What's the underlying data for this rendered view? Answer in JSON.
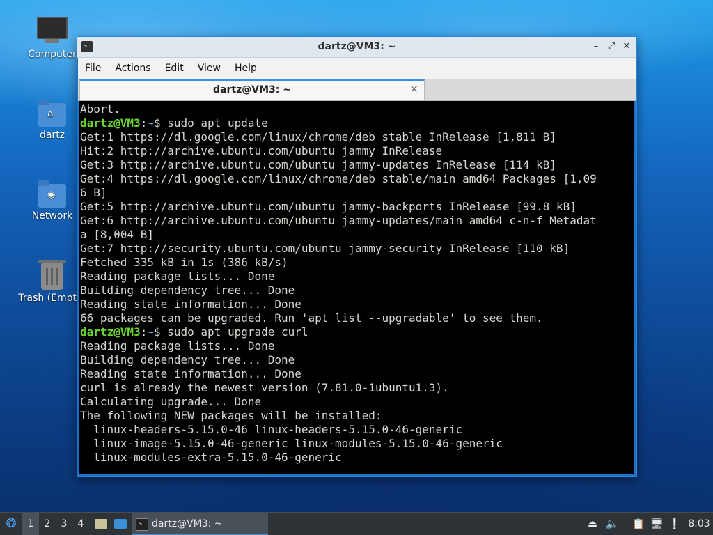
{
  "desktop": {
    "icons": [
      {
        "label": "Computer",
        "icon": "computer-icon"
      },
      {
        "label": "dartz",
        "icon": "home-folder-icon"
      },
      {
        "label": "Network",
        "icon": "network-folder-icon"
      },
      {
        "label": "Trash (Empty)",
        "icon": "trash-icon"
      }
    ]
  },
  "window": {
    "title": "dartz@VM3: ~",
    "menu": [
      "File",
      "Actions",
      "Edit",
      "View",
      "Help"
    ],
    "tab_label": "dartz@VM3: ~",
    "controls": {
      "minimize": "–",
      "maximize": "⤢",
      "close": "✕"
    }
  },
  "terminal": {
    "prompt_user": "dartz@VM3",
    "prompt_path": "~",
    "lines": [
      {
        "text": "Abort."
      },
      {
        "prompt": true,
        "text": "sudo apt update"
      },
      {
        "text": "Get:1 https://dl.google.com/linux/chrome/deb stable InRelease [1,811 B]"
      },
      {
        "text": "Hit:2 http://archive.ubuntu.com/ubuntu jammy InRelease"
      },
      {
        "text": "Get:3 http://archive.ubuntu.com/ubuntu jammy-updates InRelease [114 kB]"
      },
      {
        "text": "Get:4 https://dl.google.com/linux/chrome/deb stable/main amd64 Packages [1,09"
      },
      {
        "text": "6 B]"
      },
      {
        "text": "Get:5 http://archive.ubuntu.com/ubuntu jammy-backports InRelease [99.8 kB]"
      },
      {
        "text": "Get:6 http://archive.ubuntu.com/ubuntu jammy-updates/main amd64 c-n-f Metadat"
      },
      {
        "text": "a [8,004 B]"
      },
      {
        "text": "Get:7 http://security.ubuntu.com/ubuntu jammy-security InRelease [110 kB]"
      },
      {
        "text": "Fetched 335 kB in 1s (386 kB/s)"
      },
      {
        "text": "Reading package lists... Done"
      },
      {
        "text": "Building dependency tree... Done"
      },
      {
        "text": "Reading state information... Done"
      },
      {
        "text": "66 packages can be upgraded. Run 'apt list --upgradable' to see them."
      },
      {
        "prompt": true,
        "text": "sudo apt upgrade curl"
      },
      {
        "text": "Reading package lists... Done"
      },
      {
        "text": "Building dependency tree... Done"
      },
      {
        "text": "Reading state information... Done"
      },
      {
        "text": "curl is already the newest version (7.81.0-1ubuntu1.3)."
      },
      {
        "text": "Calculating upgrade... Done"
      },
      {
        "text": "The following NEW packages will be installed:"
      },
      {
        "text": "  linux-headers-5.15.0-46 linux-headers-5.15.0-46-generic"
      },
      {
        "text": "  linux-image-5.15.0-46-generic linux-modules-5.15.0-46-generic"
      },
      {
        "text": "  linux-modules-extra-5.15.0-46-generic"
      }
    ]
  },
  "taskbar": {
    "workspaces": [
      "1",
      "2",
      "3",
      "4"
    ],
    "active_workspace": "1",
    "task_label": "dartz@VM3: ~",
    "clock": "8:03"
  },
  "colors": {
    "prompt_user": "#6bd52f",
    "prompt_path": "#6aa0e8",
    "terminal_bg": "#000000",
    "terminal_fg": "#d3d7cf"
  }
}
